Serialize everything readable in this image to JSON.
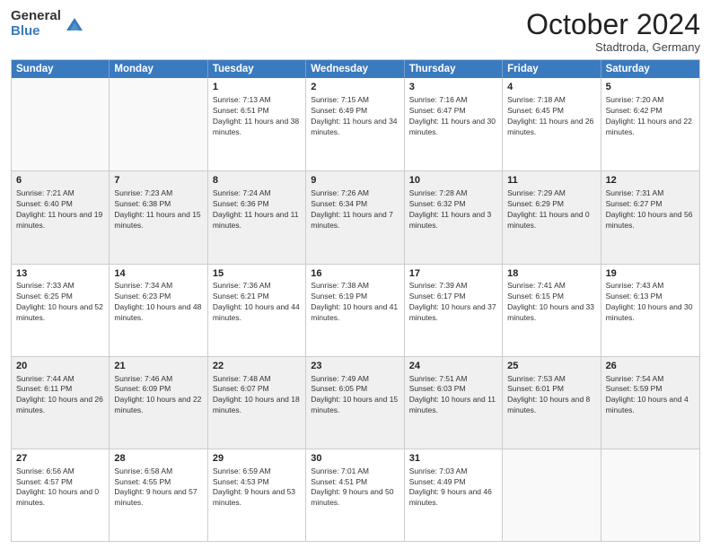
{
  "header": {
    "logo_general": "General",
    "logo_blue": "Blue",
    "month_year": "October 2024",
    "location": "Stadtroda, Germany"
  },
  "days_of_week": [
    "Sunday",
    "Monday",
    "Tuesday",
    "Wednesday",
    "Thursday",
    "Friday",
    "Saturday"
  ],
  "weeks": [
    [
      {
        "day": "",
        "sunrise": "",
        "sunset": "",
        "daylight": "",
        "empty": true
      },
      {
        "day": "",
        "sunrise": "",
        "sunset": "",
        "daylight": "",
        "empty": true
      },
      {
        "day": "1",
        "sunrise": "Sunrise: 7:13 AM",
        "sunset": "Sunset: 6:51 PM",
        "daylight": "Daylight: 11 hours and 38 minutes.",
        "empty": false
      },
      {
        "day": "2",
        "sunrise": "Sunrise: 7:15 AM",
        "sunset": "Sunset: 6:49 PM",
        "daylight": "Daylight: 11 hours and 34 minutes.",
        "empty": false
      },
      {
        "day": "3",
        "sunrise": "Sunrise: 7:16 AM",
        "sunset": "Sunset: 6:47 PM",
        "daylight": "Daylight: 11 hours and 30 minutes.",
        "empty": false
      },
      {
        "day": "4",
        "sunrise": "Sunrise: 7:18 AM",
        "sunset": "Sunset: 6:45 PM",
        "daylight": "Daylight: 11 hours and 26 minutes.",
        "empty": false
      },
      {
        "day": "5",
        "sunrise": "Sunrise: 7:20 AM",
        "sunset": "Sunset: 6:42 PM",
        "daylight": "Daylight: 11 hours and 22 minutes.",
        "empty": false
      }
    ],
    [
      {
        "day": "6",
        "sunrise": "Sunrise: 7:21 AM",
        "sunset": "Sunset: 6:40 PM",
        "daylight": "Daylight: 11 hours and 19 minutes.",
        "empty": false
      },
      {
        "day": "7",
        "sunrise": "Sunrise: 7:23 AM",
        "sunset": "Sunset: 6:38 PM",
        "daylight": "Daylight: 11 hours and 15 minutes.",
        "empty": false
      },
      {
        "day": "8",
        "sunrise": "Sunrise: 7:24 AM",
        "sunset": "Sunset: 6:36 PM",
        "daylight": "Daylight: 11 hours and 11 minutes.",
        "empty": false
      },
      {
        "day": "9",
        "sunrise": "Sunrise: 7:26 AM",
        "sunset": "Sunset: 6:34 PM",
        "daylight": "Daylight: 11 hours and 7 minutes.",
        "empty": false
      },
      {
        "day": "10",
        "sunrise": "Sunrise: 7:28 AM",
        "sunset": "Sunset: 6:32 PM",
        "daylight": "Daylight: 11 hours and 3 minutes.",
        "empty": false
      },
      {
        "day": "11",
        "sunrise": "Sunrise: 7:29 AM",
        "sunset": "Sunset: 6:29 PM",
        "daylight": "Daylight: 11 hours and 0 minutes.",
        "empty": false
      },
      {
        "day": "12",
        "sunrise": "Sunrise: 7:31 AM",
        "sunset": "Sunset: 6:27 PM",
        "daylight": "Daylight: 10 hours and 56 minutes.",
        "empty": false
      }
    ],
    [
      {
        "day": "13",
        "sunrise": "Sunrise: 7:33 AM",
        "sunset": "Sunset: 6:25 PM",
        "daylight": "Daylight: 10 hours and 52 minutes.",
        "empty": false
      },
      {
        "day": "14",
        "sunrise": "Sunrise: 7:34 AM",
        "sunset": "Sunset: 6:23 PM",
        "daylight": "Daylight: 10 hours and 48 minutes.",
        "empty": false
      },
      {
        "day": "15",
        "sunrise": "Sunrise: 7:36 AM",
        "sunset": "Sunset: 6:21 PM",
        "daylight": "Daylight: 10 hours and 44 minutes.",
        "empty": false
      },
      {
        "day": "16",
        "sunrise": "Sunrise: 7:38 AM",
        "sunset": "Sunset: 6:19 PM",
        "daylight": "Daylight: 10 hours and 41 minutes.",
        "empty": false
      },
      {
        "day": "17",
        "sunrise": "Sunrise: 7:39 AM",
        "sunset": "Sunset: 6:17 PM",
        "daylight": "Daylight: 10 hours and 37 minutes.",
        "empty": false
      },
      {
        "day": "18",
        "sunrise": "Sunrise: 7:41 AM",
        "sunset": "Sunset: 6:15 PM",
        "daylight": "Daylight: 10 hours and 33 minutes.",
        "empty": false
      },
      {
        "day": "19",
        "sunrise": "Sunrise: 7:43 AM",
        "sunset": "Sunset: 6:13 PM",
        "daylight": "Daylight: 10 hours and 30 minutes.",
        "empty": false
      }
    ],
    [
      {
        "day": "20",
        "sunrise": "Sunrise: 7:44 AM",
        "sunset": "Sunset: 6:11 PM",
        "daylight": "Daylight: 10 hours and 26 minutes.",
        "empty": false
      },
      {
        "day": "21",
        "sunrise": "Sunrise: 7:46 AM",
        "sunset": "Sunset: 6:09 PM",
        "daylight": "Daylight: 10 hours and 22 minutes.",
        "empty": false
      },
      {
        "day": "22",
        "sunrise": "Sunrise: 7:48 AM",
        "sunset": "Sunset: 6:07 PM",
        "daylight": "Daylight: 10 hours and 18 minutes.",
        "empty": false
      },
      {
        "day": "23",
        "sunrise": "Sunrise: 7:49 AM",
        "sunset": "Sunset: 6:05 PM",
        "daylight": "Daylight: 10 hours and 15 minutes.",
        "empty": false
      },
      {
        "day": "24",
        "sunrise": "Sunrise: 7:51 AM",
        "sunset": "Sunset: 6:03 PM",
        "daylight": "Daylight: 10 hours and 11 minutes.",
        "empty": false
      },
      {
        "day": "25",
        "sunrise": "Sunrise: 7:53 AM",
        "sunset": "Sunset: 6:01 PM",
        "daylight": "Daylight: 10 hours and 8 minutes.",
        "empty": false
      },
      {
        "day": "26",
        "sunrise": "Sunrise: 7:54 AM",
        "sunset": "Sunset: 5:59 PM",
        "daylight": "Daylight: 10 hours and 4 minutes.",
        "empty": false
      }
    ],
    [
      {
        "day": "27",
        "sunrise": "Sunrise: 6:56 AM",
        "sunset": "Sunset: 4:57 PM",
        "daylight": "Daylight: 10 hours and 0 minutes.",
        "empty": false
      },
      {
        "day": "28",
        "sunrise": "Sunrise: 6:58 AM",
        "sunset": "Sunset: 4:55 PM",
        "daylight": "Daylight: 9 hours and 57 minutes.",
        "empty": false
      },
      {
        "day": "29",
        "sunrise": "Sunrise: 6:59 AM",
        "sunset": "Sunset: 4:53 PM",
        "daylight": "Daylight: 9 hours and 53 minutes.",
        "empty": false
      },
      {
        "day": "30",
        "sunrise": "Sunrise: 7:01 AM",
        "sunset": "Sunset: 4:51 PM",
        "daylight": "Daylight: 9 hours and 50 minutes.",
        "empty": false
      },
      {
        "day": "31",
        "sunrise": "Sunrise: 7:03 AM",
        "sunset": "Sunset: 4:49 PM",
        "daylight": "Daylight: 9 hours and 46 minutes.",
        "empty": false
      },
      {
        "day": "",
        "sunrise": "",
        "sunset": "",
        "daylight": "",
        "empty": true
      },
      {
        "day": "",
        "sunrise": "",
        "sunset": "",
        "daylight": "",
        "empty": true
      }
    ]
  ]
}
